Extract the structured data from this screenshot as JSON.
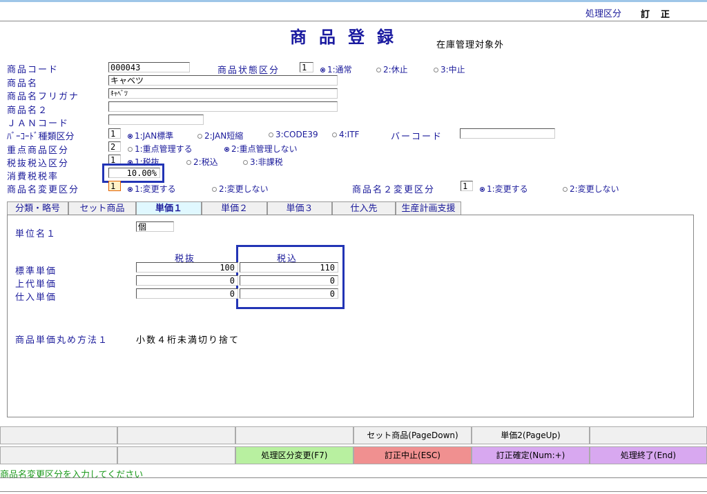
{
  "header": {
    "mode_label": "処理区分",
    "mode_value": "訂正",
    "title": "商品登録",
    "subtitle": "在庫管理対象外"
  },
  "form": {
    "product_code": {
      "label": "商品コード",
      "value": "000043"
    },
    "product_status": {
      "label": "商品状態区分",
      "value": "1",
      "options": [
        "1:通常",
        "2:休止",
        "3:中止"
      ],
      "selected": 0
    },
    "product_name": {
      "label": "商品名",
      "value": "キャベツ"
    },
    "product_kana": {
      "label": "商品名フリガナ",
      "value": "ｷｬﾍﾞﾂ"
    },
    "product_name2": {
      "label": "商品名２",
      "value": ""
    },
    "jan_code": {
      "label": "ＪＡＮコード",
      "value": ""
    },
    "barcode_type": {
      "label": "ﾊﾞｰｺｰﾄﾞ種類区分",
      "value": "1",
      "options": [
        "1:JAN標準",
        "2:JAN短縮",
        "3:CODE39",
        "4:ITF"
      ],
      "selected": 0
    },
    "barcode": {
      "label": "バーコード",
      "value": ""
    },
    "priority": {
      "label": "重点商品区分",
      "value": "2",
      "options": [
        "1:重点管理する",
        "2:重点管理しない"
      ],
      "selected": 1
    },
    "tax_type": {
      "label": "税抜税込区分",
      "value": "1",
      "options": [
        "1:税抜",
        "2:税込",
        "3:非課税"
      ],
      "selected": 0
    },
    "tax_rate": {
      "label": "消費税税率",
      "value": "10.00%"
    },
    "name_change": {
      "label": "商品名変更区分",
      "value": "1",
      "options": [
        "1:変更する",
        "2:変更しない"
      ],
      "selected": 0
    },
    "name2_change": {
      "label": "商品名２変更区分",
      "value": "1",
      "options": [
        "1:変更する",
        "2:変更しない"
      ],
      "selected": 0
    }
  },
  "tabs": [
    "分類・略号",
    "セット商品",
    "単価１",
    "単価２",
    "単価３",
    "仕入先",
    "生産計画支援"
  ],
  "active_tab": 2,
  "panel": {
    "unit_label": "単位名１",
    "unit_value": "個",
    "col_ex": "税抜",
    "col_in": "税込",
    "rows": [
      {
        "label": "標準単価",
        "ex": "100",
        "in": "110"
      },
      {
        "label": "上代単価",
        "ex": "0",
        "in": "0"
      },
      {
        "label": "仕入単価",
        "ex": "0",
        "in": "0"
      }
    ],
    "rounding_label": "商品単価丸め方法１",
    "rounding_value": "小数４桁未満切り捨て"
  },
  "fkeys_row1": [
    "",
    "",
    "",
    "セット商品(PageDown)",
    "単価2(PageUp)",
    ""
  ],
  "fkeys_row2": [
    "",
    "",
    "処理区分変更(F7)",
    "訂正中止(ESC)",
    "訂正確定(Num:+)",
    "処理終了(End)"
  ],
  "fkey_colors_row2": [
    "#f0f0f0",
    "#f0f0f0",
    "#b8f0a0",
    "#f09090",
    "#d8a8f0",
    "#d8a8f0"
  ],
  "status_message": "商品名変更区分を入力してください"
}
